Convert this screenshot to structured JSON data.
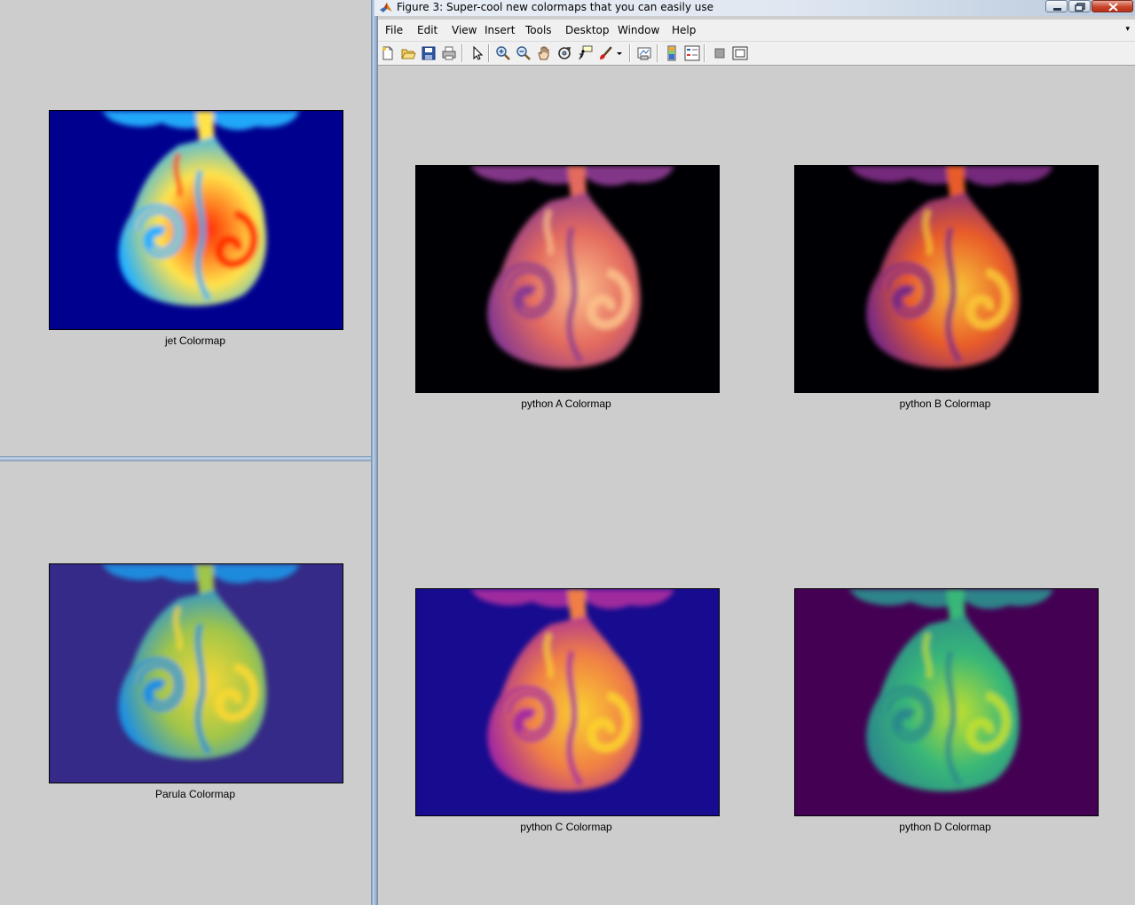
{
  "window": {
    "title": "Figure 3: Super-cool new colormaps that you can easily use",
    "icon": "matlab-logo-icon"
  },
  "menu": [
    "File",
    "Edit",
    "View",
    "Insert",
    "Tools",
    "Desktop",
    "Window",
    "Help"
  ],
  "toolbar": [
    "new-figure-icon",
    "open-file-icon",
    "save-icon",
    "print-icon",
    "edit-plot-icon",
    "zoom-in-icon",
    "zoom-out-icon",
    "pan-icon",
    "rotate-3d-icon",
    "data-cursor-icon",
    "brush-icon",
    "brush-dropdown-icon",
    "link-plot-icon",
    "insert-colorbar-icon",
    "insert-legend-icon",
    "hide-plot-tools-icon",
    "show-plot-tools-icon"
  ],
  "background_figures": [
    {
      "caption": "jet Colormap",
      "colors": {
        "background": "#00008f",
        "outer": "#23b0ff",
        "inner": "#ff2a00",
        "mid": "#ffe34a"
      }
    },
    {
      "caption": "Parula Colormap",
      "colors": {
        "background": "#352a87",
        "outer": "#1e8fe0",
        "inner": "#f9d832",
        "mid": "#9fc54a"
      }
    }
  ],
  "figure3_panels": [
    {
      "caption": "python A Colormap",
      "colors": {
        "background": "#000004",
        "outer": "#8a3a8f",
        "inner": "#fcbf8a",
        "mid": "#e36a5e"
      }
    },
    {
      "caption": "python B Colormap",
      "colors": {
        "background": "#000004",
        "outer": "#7b2a82",
        "inner": "#f9c436",
        "mid": "#e85b2a"
      }
    },
    {
      "caption": "python C Colormap",
      "colors": {
        "background": "#170b8f",
        "outer": "#a62a9e",
        "inner": "#fbd12e",
        "mid": "#f07f45"
      }
    },
    {
      "caption": "python D Colormap",
      "colors": {
        "background": "#440154",
        "outer": "#2c8a8b",
        "inner": "#bfdf2f",
        "mid": "#38b778"
      }
    }
  ]
}
